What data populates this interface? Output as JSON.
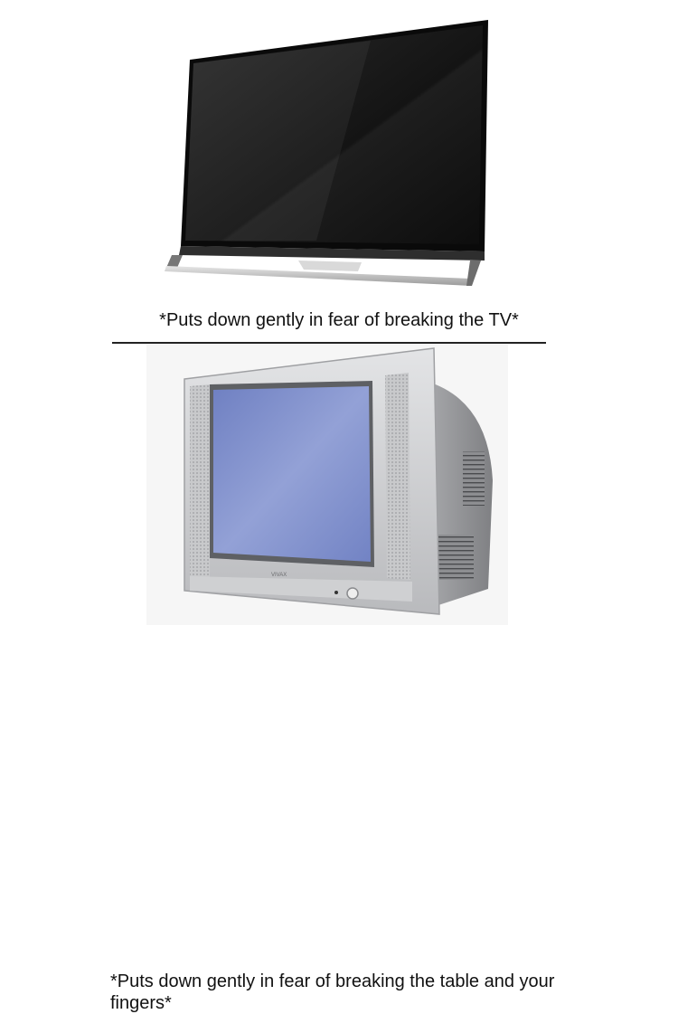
{
  "panels": {
    "top": {
      "caption": "*Puts down gently in fear of breaking the TV*",
      "image": "flat-screen-tv"
    },
    "bottom": {
      "caption": "*Puts down gently in fear of breaking the table and your fingers*",
      "image": "crt-tv",
      "brand_text": "VIVAX"
    }
  },
  "colors": {
    "background": "#ffffff",
    "divider": "#222222",
    "flat_screen": "#1a1a1a",
    "crt_body": "#c9cacc",
    "crt_screen": "#7f8fc8"
  }
}
